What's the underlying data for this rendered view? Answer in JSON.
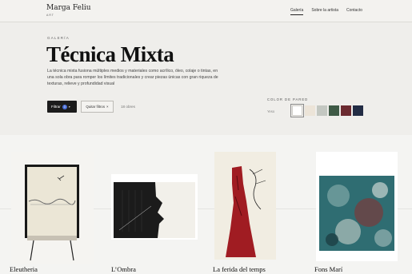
{
  "header": {
    "brand_name": "Marga Feliu",
    "brand_sub": "ART",
    "nav": [
      {
        "label": "Galería",
        "active": true
      },
      {
        "label": "Sobre la artista",
        "active": false
      },
      {
        "label": "Contacto",
        "active": false
      }
    ]
  },
  "hero": {
    "eyebrow": "GALERÍA",
    "title": "Técnica Mixta",
    "description": "La técnica mixta fusiona múltiples medios y materiales como acrílico, óleo, colaje o tintas, en una sola obra para romper los límites tradicionales y crear piezas únicas con gran riqueza de texturas, relieve y profundidad visual"
  },
  "controls": {
    "filter_label": "Filtrar",
    "filter_count": "3",
    "filter_chevron": "▾",
    "clear_label": "Quitar filtros",
    "clear_icon": "×",
    "results": "18 obres"
  },
  "wall_color": {
    "label": "COLOR DE PARED",
    "current": "Yeso",
    "swatches": [
      {
        "color": "#ffffff",
        "selected": true
      },
      {
        "color": "#ece4d8",
        "selected": false
      },
      {
        "color": "#c3c7c1",
        "selected": false
      },
      {
        "color": "#3f5a46",
        "selected": false
      },
      {
        "color": "#6b2a30",
        "selected": false
      },
      {
        "color": "#222c44",
        "selected": false
      }
    ]
  },
  "artworks": [
    {
      "title": "Eleutheria"
    },
    {
      "title": "L’Ombra"
    },
    {
      "title": "La ferida del temps"
    },
    {
      "title": "Fons Marí"
    }
  ]
}
